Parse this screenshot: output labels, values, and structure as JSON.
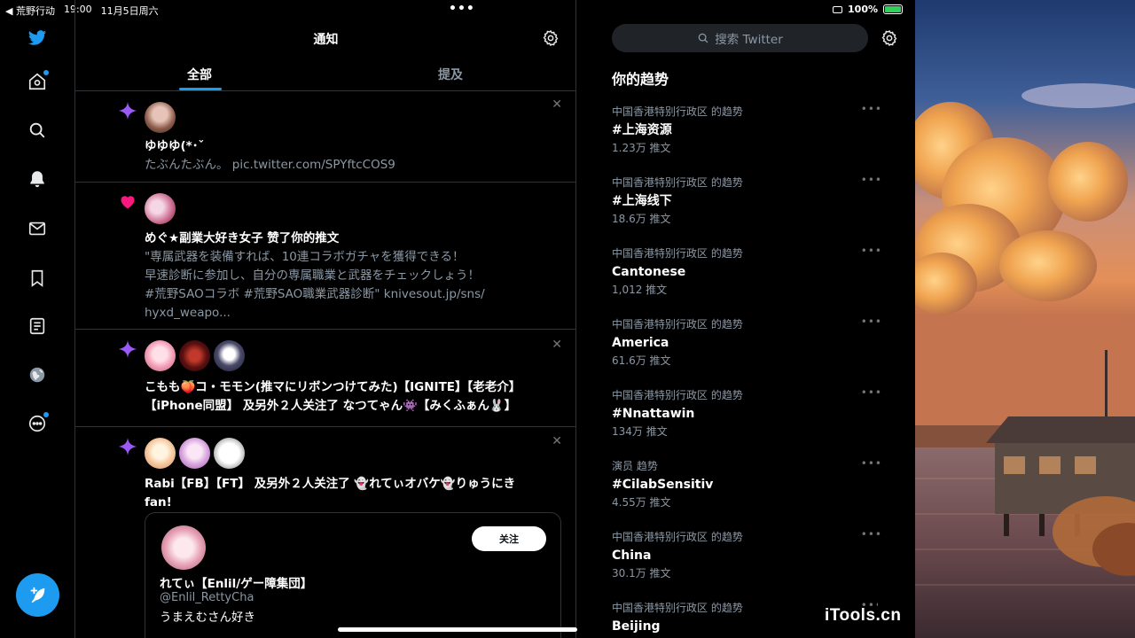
{
  "status_bar": {
    "back_app": "◀ 荒野行动",
    "time": "19:00",
    "date": "11月5日周六",
    "battery": "100%"
  },
  "header": {
    "title": "通知"
  },
  "tabs": [
    {
      "label": "全部"
    },
    {
      "label": "提及"
    }
  ],
  "notifications": [
    {
      "name": "ゆゆゆ(*･ˇ",
      "text": "たぶんたぶん。 pic.twitter.com/SPYftcCOS9"
    },
    {
      "headline_name": "めぐ★副業大好き女子",
      "headline_action": " 赞了你的推文",
      "lines": [
        "\"専属武器を装備すれば、10連コラボガチャを獲得できる！",
        "早速診断に参加し、自分の専属職業と武器をチェックしょう！",
        "#荒野SAOコラボ #荒野SAO職業武器診断\" knivesout.jp/sns/",
        "hyxd_weapo..."
      ]
    },
    {
      "line1": "こもも🍑コ・モモン(推マにリボンつけてみた)【IGNITE】【老老介】",
      "line2": "【iPhone同盟】 及另外２人关注了 なつてゃん👾【みくふぁん🐰】"
    },
    {
      "line1": "Rabi【FB】【FT】 及另外２人关注了 👻れてぃオバケ👻りゅうにき",
      "line2": "fan!",
      "card": {
        "follow_label": "关注",
        "name": "れてぃ【Enlil/ゲー障集団】",
        "handle": "@Enlil_RettyCha",
        "bio": "うまえむさん好き"
      }
    }
  ],
  "search": {
    "placeholder": "搜索 Twitter"
  },
  "trends": {
    "title": "你的趋势",
    "items": [
      {
        "context": "中国香港特别行政区 的趋势",
        "name": "#上海资源",
        "count": "1.23万 推文"
      },
      {
        "context": "中国香港特别行政区 的趋势",
        "name": "#上海线下",
        "count": "18.6万 推文"
      },
      {
        "context": "中国香港特别行政区 的趋势",
        "name": "Cantonese",
        "count": "1,012 推文"
      },
      {
        "context": "中国香港特别行政区 的趋势",
        "name": "America",
        "count": "61.6万 推文"
      },
      {
        "context": "中国香港特别行政区 的趋势",
        "name": "#Nnattawin",
        "count": "134万 推文"
      },
      {
        "context": "演员 趋势",
        "name": "#CilabSensitiv",
        "count": "4.55万 推文"
      },
      {
        "context": "中国香港特别行政区 的趋势",
        "name": "China",
        "count": "30.1万 推文"
      },
      {
        "context": "中国香港特别行政区 的趋势",
        "name": "Beijing",
        "count": ""
      }
    ]
  },
  "watermark": "iTools.cn",
  "icons": {
    "logo": "twitter-bird-icon",
    "nav": [
      "home-icon",
      "search-icon",
      "bell-icon",
      "mail-icon",
      "bookmark-icon",
      "lists-icon",
      "globe-icon",
      "more-icon"
    ],
    "compose": "feather-compose-icon"
  },
  "colors": {
    "accent": "#1d9bf0",
    "background": "#000000",
    "border": "#2f3336",
    "muted_text": "#8b98a5",
    "star": "#9b59f6",
    "heart": "#f91880"
  }
}
